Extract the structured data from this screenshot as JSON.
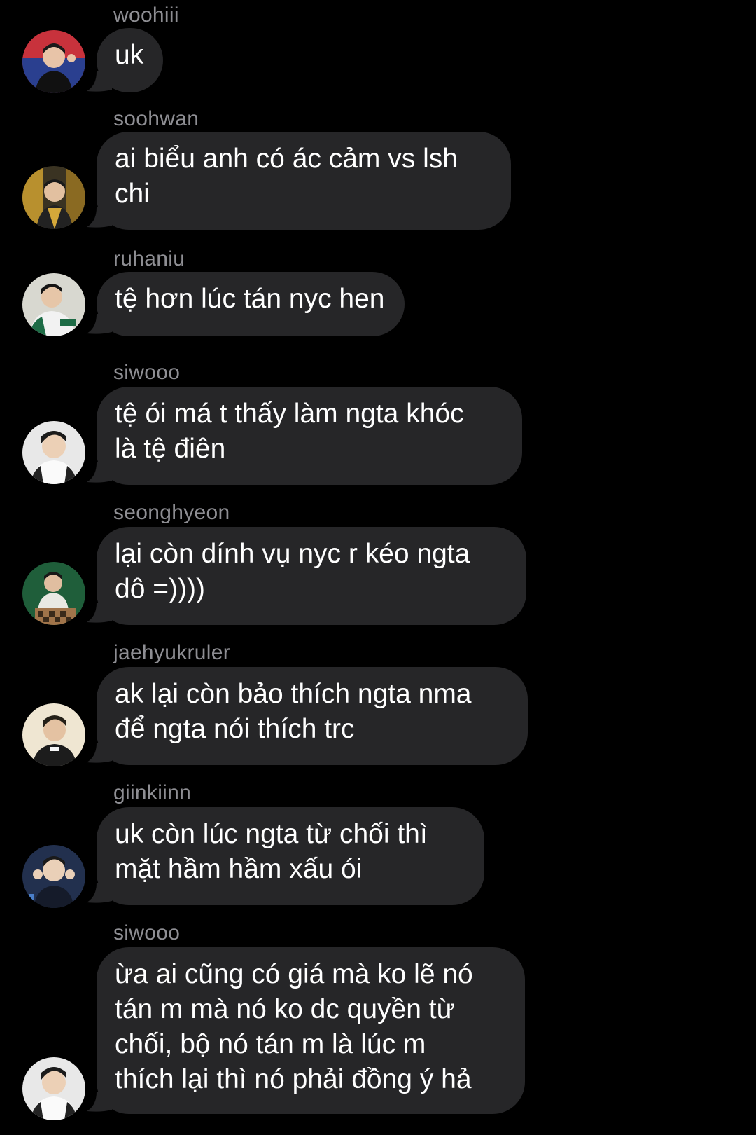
{
  "conversation": {
    "messages": [
      {
        "sender": "woohiii",
        "text": "uk",
        "avatar": "profile-photo-red-blue"
      },
      {
        "sender": "soohwan",
        "text": "ai biểu anh có ác cảm vs lsh\nchi",
        "avatar": "profile-photo-gold"
      },
      {
        "sender": "ruhaniu",
        "text": "tệ hơn lúc tán nyc hen",
        "avatar": "profile-photo-green-white"
      },
      {
        "sender": "siwooo",
        "text": "tệ ói má t thấy làm ngta khóc\nlà tệ điên",
        "avatar": "profile-photo-white-jersey"
      },
      {
        "sender": "seonghyeon",
        "text": "lại còn dính vụ nyc r kéo ngta\ndô =))))",
        "avatar": "profile-photo-green-chess"
      },
      {
        "sender": "jaehyukruler",
        "text": "ak lại còn bảo thích ngta nma\nđể ngta nói thích trc",
        "avatar": "profile-photo-cream"
      },
      {
        "sender": "giinkiinn",
        "text": "uk còn lúc ngta từ chối thì\nmặt hầm hầm xấu ói",
        "avatar": "profile-photo-navy"
      },
      {
        "sender": "siwooo",
        "text": "ừa ai cũng có giá mà ko lẽ nó\ntán m mà nó ko dc quyền từ\nchối, bộ nó tán m là lúc m\nthích lại thì nó phải đồng ý hả",
        "avatar": "profile-photo-white-jersey"
      }
    ]
  },
  "colors": {
    "background": "#000000",
    "bubble": "#262628",
    "sender_text": "#8e8e93",
    "message_text": "#ffffff"
  }
}
